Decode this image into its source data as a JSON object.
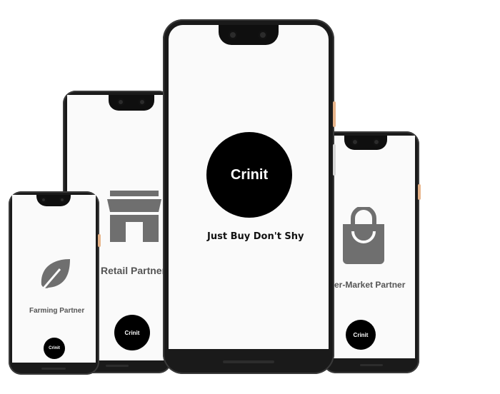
{
  "brand": {
    "name": "Crinit",
    "tagline": "Just Buy Don't Shy"
  },
  "partners": {
    "farming": {
      "label": "Farming Partner",
      "icon": "leaf-icon"
    },
    "retail": {
      "label": "Retail Partner",
      "icon": "storefront-icon"
    },
    "supermarket": {
      "label": "er-Market Partner",
      "icon": "shopping-bag-icon"
    }
  },
  "colors": {
    "icon_gray": "#6f6f6f",
    "logo_bg": "#000000",
    "accent_button": "#e7b48a"
  }
}
